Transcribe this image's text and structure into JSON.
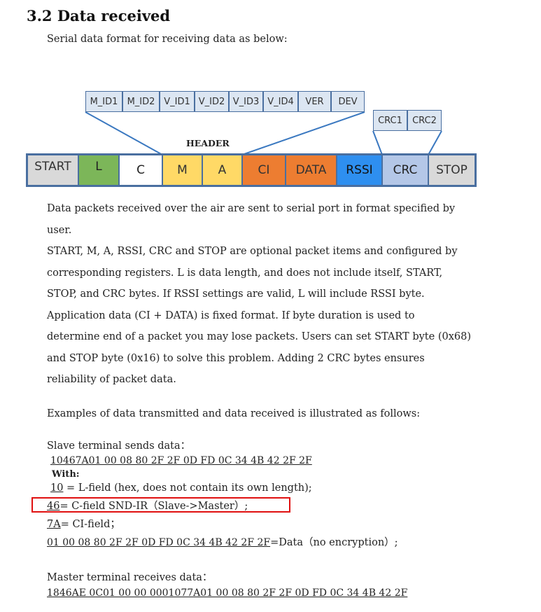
{
  "section": {
    "title": "3.2 Data received",
    "intro": "Serial data format for receiving data as below:"
  },
  "header_fields": [
    "M_ID1",
    "M_ID2",
    "V_ID1",
    "V_ID2",
    "V_ID3",
    "V_ID4",
    "VER",
    "DEV"
  ],
  "crc_fields": [
    "CRC1",
    "CRC2"
  ],
  "header_label": "HEADER",
  "frame_fields": [
    {
      "label": "START",
      "color": "#d9d9d9"
    },
    {
      "label": "L",
      "color": "#7cb659"
    },
    {
      "label": "C",
      "color": "#ffffff"
    },
    {
      "label": "M",
      "color": "#ffd966"
    },
    {
      "label": "A",
      "color": "#ffd966"
    },
    {
      "label": "CI",
      "color": "#ed7d31"
    },
    {
      "label": "DATA",
      "color": "#ed7d31"
    },
    {
      "label": "RSSI",
      "color": "#2e8ff0"
    },
    {
      "label": "CRC",
      "color": "#b4c7e7"
    },
    {
      "label": "STOP",
      "color": "#d9d9d9"
    }
  ],
  "paragraph_lines": [
    "Data packets received over the air are sent to serial port in format specified by",
    "user.",
    "START, M, A, RSSI, CRC and STOP are optional packet items and configured by",
    "corresponding registers. L is data length, and does not include itself, START,",
    "STOP, and CRC bytes. If RSSI settings are valid, L will include RSSI byte.",
    "Application data (CI + DATA) is fixed format. If byte duration is used to",
    "determine end of a packet you may lose packets. Users can set START byte (0x68)",
    "and STOP byte (0x16) to solve this problem. Adding 2 CRC bytes ensures",
    "reliability of packet data."
  ],
  "examples_intro": "Examples of data transmitted and data received is illustrated as follows:",
  "slave": {
    "heading": "Slave terminal sends data：",
    "hex": "10467A01 00 08 80 2F 2F 0D FD 0C 34 4B 42 2F 2F",
    "with_label": "With:",
    "items": [
      {
        "code": "10",
        "desc": " = L-field (hex, does not contain its own length);"
      },
      {
        "code": "46",
        "desc": "= C-field SND-IR（Slave->Master）;"
      },
      {
        "code": "7A",
        "desc": "= CI-field；"
      },
      {
        "code": "01 00 08 80 2F 2F 0D FD 0C 34 4B 42 2F 2F",
        "desc": "=Data（no encryption）;"
      }
    ]
  },
  "master": {
    "heading": "Master terminal receives data：",
    "hex": "1846AE 0C01 00 00 0001077A01 00 08 80 2F 2F 0D FD 0C 34 4B 42 2F"
  }
}
